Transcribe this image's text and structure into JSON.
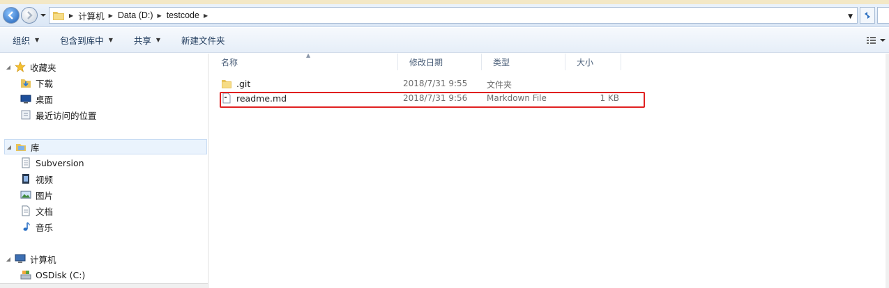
{
  "breadcrumb": [
    "计算机",
    "Data (D:)",
    "testcode"
  ],
  "toolbar": {
    "organize": "组织",
    "include_in_library": "包含到库中",
    "share": "共享",
    "new_folder": "新建文件夹"
  },
  "sidebar": {
    "favorites": {
      "label": "收藏夹",
      "items": [
        "下载",
        "桌面",
        "最近访问的位置"
      ]
    },
    "libraries": {
      "label": "库",
      "items": [
        "Subversion",
        "视频",
        "图片",
        "文档",
        "音乐"
      ]
    },
    "computer": {
      "label": "计算机",
      "items": [
        "OSDisk (C:)"
      ]
    }
  },
  "columns": {
    "name": "名称",
    "modified": "修改日期",
    "type": "类型",
    "size": "大小"
  },
  "files": [
    {
      "name": ".git",
      "modified": "2018/7/31 9:55",
      "type": "文件夹",
      "size": "",
      "icon": "folder-icon"
    },
    {
      "name": "readme.md",
      "modified": "2018/7/31 9:56",
      "type": "Markdown File",
      "size": "1 KB",
      "icon": "file-icon"
    }
  ],
  "colors": {
    "highlight_border": "#e02020",
    "selected_nav_bg": "#eaf3fd",
    "toolbar_text": "#1e395b"
  }
}
